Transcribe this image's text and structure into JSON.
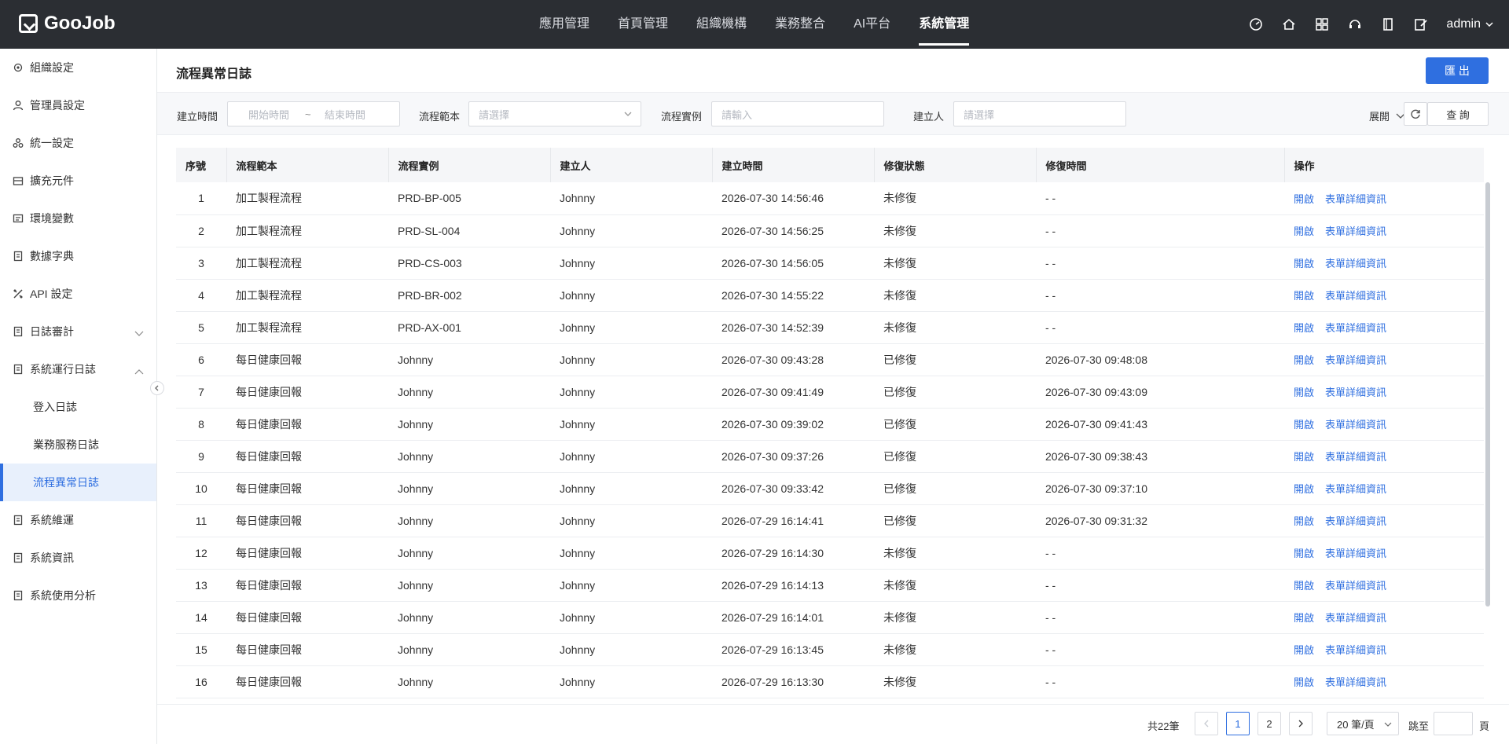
{
  "app": {
    "logo_text": "GooJob"
  },
  "topnav": {
    "items": [
      "應用管理",
      "首頁管理",
      "組織機構",
      "業務整合",
      "AI平台",
      "系統管理"
    ],
    "active_index": 5
  },
  "topbar": {
    "user": "admin"
  },
  "sidebar": {
    "items": [
      {
        "label": "組織設定"
      },
      {
        "label": "管理員設定"
      },
      {
        "label": "統一設定"
      },
      {
        "label": "擴充元件"
      },
      {
        "label": "環境變數"
      },
      {
        "label": "數據字典"
      },
      {
        "label": "API 設定"
      },
      {
        "label": "日誌審計"
      },
      {
        "label": "系統運行日誌"
      },
      {
        "label": "系統維運"
      },
      {
        "label": "系統資訊"
      },
      {
        "label": "系統使用分析"
      }
    ],
    "sub_items": [
      "登入日誌",
      "業務服務日誌",
      "流程異常日誌"
    ],
    "active_sub": "流程異常日誌"
  },
  "page": {
    "title": "流程異常日誌",
    "export_label": "匯 出"
  },
  "filters": {
    "created_time_label": "建立時間",
    "start_placeholder": "開始時間",
    "range_sep": "~",
    "end_placeholder": "結束時間",
    "template_label": "流程範本",
    "template_placeholder": "請選擇",
    "instance_label": "流程實例",
    "instance_placeholder": "請輸入",
    "creator_label": "建立人",
    "creator_placeholder": "請選擇",
    "expand_label": "展開",
    "query_label": "查 詢"
  },
  "table": {
    "headers": [
      "序號",
      "流程範本",
      "流程實例",
      "建立人",
      "建立時間",
      "修復狀態",
      "修復時間",
      "操作"
    ],
    "action_open": "開啟",
    "action_detail": "表單詳細資訊",
    "rows": [
      [
        "1",
        "加工製程流程",
        "PRD-BP-005",
        "Johnny",
        "2026-07-30 14:56:46",
        "未修復",
        "- -"
      ],
      [
        "2",
        "加工製程流程",
        "PRD-SL-004",
        "Johnny",
        "2026-07-30 14:56:25",
        "未修復",
        "- -"
      ],
      [
        "3",
        "加工製程流程",
        "PRD-CS-003",
        "Johnny",
        "2026-07-30 14:56:05",
        "未修復",
        "- -"
      ],
      [
        "4",
        "加工製程流程",
        "PRD-BR-002",
        "Johnny",
        "2026-07-30 14:55:22",
        "未修復",
        "- -"
      ],
      [
        "5",
        "加工製程流程",
        "PRD-AX-001",
        "Johnny",
        "2026-07-30 14:52:39",
        "未修復",
        "- -"
      ],
      [
        "6",
        "每日健康回報",
        "Johnny",
        "Johnny",
        "2026-07-30 09:43:28",
        "已修復",
        "2026-07-30 09:48:08"
      ],
      [
        "7",
        "每日健康回報",
        "Johnny",
        "Johnny",
        "2026-07-30 09:41:49",
        "已修復",
        "2026-07-30 09:43:09"
      ],
      [
        "8",
        "每日健康回報",
        "Johnny",
        "Johnny",
        "2026-07-30 09:39:02",
        "已修復",
        "2026-07-30 09:41:43"
      ],
      [
        "9",
        "每日健康回報",
        "Johnny",
        "Johnny",
        "2026-07-30 09:37:26",
        "已修復",
        "2026-07-30 09:38:43"
      ],
      [
        "10",
        "每日健康回報",
        "Johnny",
        "Johnny",
        "2026-07-30 09:33:42",
        "已修復",
        "2026-07-30 09:37:10"
      ],
      [
        "11",
        "每日健康回報",
        "Johnny",
        "Johnny",
        "2026-07-29 16:14:41",
        "已修復",
        "2026-07-30 09:31:32"
      ],
      [
        "12",
        "每日健康回報",
        "Johnny",
        "Johnny",
        "2026-07-29 16:14:30",
        "未修復",
        "- -"
      ],
      [
        "13",
        "每日健康回報",
        "Johnny",
        "Johnny",
        "2026-07-29 16:14:13",
        "未修復",
        "- -"
      ],
      [
        "14",
        "每日健康回報",
        "Johnny",
        "Johnny",
        "2026-07-29 16:14:01",
        "未修復",
        "- -"
      ],
      [
        "15",
        "每日健康回報",
        "Johnny",
        "Johnny",
        "2026-07-29 16:13:45",
        "未修復",
        "- -"
      ],
      [
        "16",
        "每日健康回報",
        "Johnny",
        "Johnny",
        "2026-07-29 16:13:30",
        "未修復",
        "- -"
      ]
    ]
  },
  "pager": {
    "total": "共22筆",
    "pages": [
      "1",
      "2"
    ],
    "current": "1",
    "page_size": "20 筆/頁",
    "jump_label": "跳至",
    "page_unit": "頁"
  },
  "colors": {
    "topbar": "#2b2e33",
    "accent": "#2f6fe0"
  }
}
